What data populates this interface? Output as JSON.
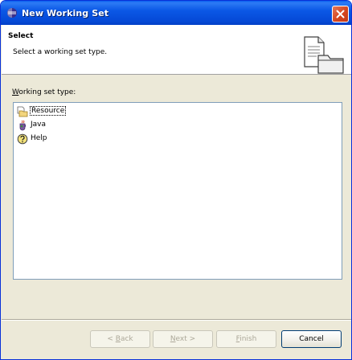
{
  "window": {
    "title": "New Working Set",
    "accent": "#0b58e6"
  },
  "header": {
    "title": "Select",
    "description": "Select a working set type."
  },
  "list": {
    "label_mnemonic": "W",
    "label_rest": "orking set type:",
    "items": [
      {
        "label": "Resource",
        "icon": "resource-folder-icon",
        "selected": true
      },
      {
        "label": "Java",
        "icon": "java-icon",
        "selected": false
      },
      {
        "label": "Help",
        "icon": "help-icon",
        "selected": false
      }
    ]
  },
  "buttons": {
    "back_prefix": "< ",
    "back_mnemonic": "B",
    "back_rest": "ack",
    "next_mnemonic": "N",
    "next_rest": "ext >",
    "finish_mnemonic": "F",
    "finish_rest": "inish",
    "cancel": "Cancel"
  }
}
